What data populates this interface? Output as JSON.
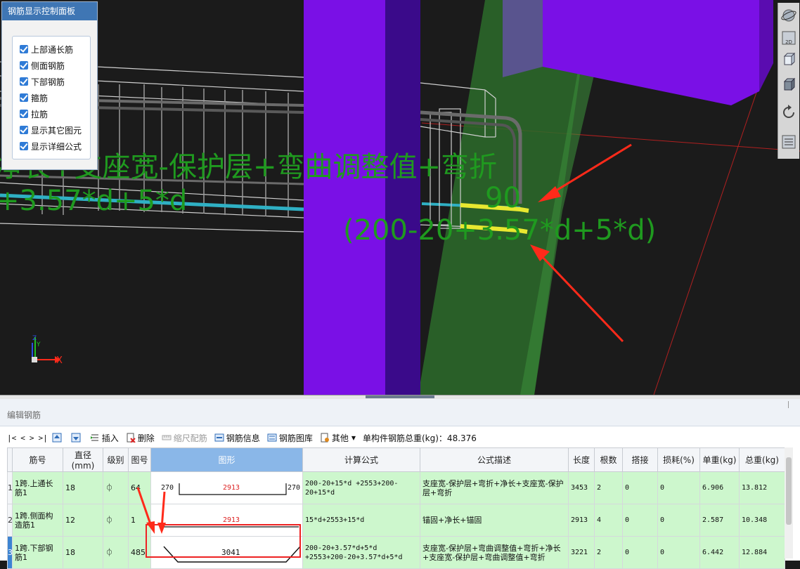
{
  "overlay": {
    "formula_line1": "净长+支座宽-保护层+弯曲调整值+弯折",
    "formula_line2": "+3.57*d+5*d",
    "value_90": "90",
    "value_formula": "(200-20+3.57*d+5*d)"
  },
  "axes": {
    "x": "X",
    "y": "Y",
    "z": "Z"
  },
  "control_panel": {
    "title": "钢筋显示控制面板",
    "items": [
      {
        "label": "上部通长筋",
        "checked": true
      },
      {
        "label": "侧面钢筋",
        "checked": true
      },
      {
        "label": "下部钢筋",
        "checked": true
      },
      {
        "label": "箍筋",
        "checked": true
      },
      {
        "label": "拉筋",
        "checked": true
      },
      {
        "label": "显示其它图元",
        "checked": true
      },
      {
        "label": "显示详细公式",
        "checked": true
      }
    ]
  },
  "right_toolbar": {
    "items": [
      "orbit-icon",
      "2d-view-icon",
      "3d-box-icon",
      "solid-box-icon",
      "rotate-icon",
      "grid-view-icon"
    ],
    "view_label": "2D"
  },
  "editor": {
    "title": "编辑钢筋",
    "toolbar": {
      "nav": [
        "|<",
        "<",
        ">",
        ">|"
      ],
      "insert": "插入",
      "delete": "删除",
      "scale": "缩尺配筋",
      "rebar_info": "钢筋信息",
      "rebar_library": "钢筋图库",
      "other": "其他",
      "total_label": "单构件钢筋总重(kg)：48.376"
    },
    "columns": [
      "",
      "筋号",
      "直径(mm)",
      "级别",
      "图号",
      "图形",
      "计算公式",
      "公式描述",
      "长度",
      "根数",
      "搭接",
      "损耗(%)",
      "单重(kg)",
      "总重(kg)"
    ],
    "rows": [
      {
        "num": "1",
        "name": "1跨.上通长筋1",
        "diameter": "18",
        "grade": "⏀",
        "fig": "64",
        "shape_left": "270",
        "shape_mid": "2913",
        "shape_right": "270",
        "formula": "200-20+15*d +2553+200-20+15*d",
        "desc": "支座宽-保护层+弯折+净长+支座宽-保护层+弯折",
        "length": "3453",
        "count": "2",
        "lap": "0",
        "loss": "0",
        "unit_wt": "6.906",
        "total_wt": "13.812"
      },
      {
        "num": "2",
        "name": "1跨.侧面构造筋1",
        "diameter": "12",
        "grade": "⏀",
        "fig": "1",
        "shape_mid": "2913",
        "formula": "15*d+2553+15*d",
        "desc": "锚固+净长+锚固",
        "length": "2913",
        "count": "4",
        "lap": "0",
        "loss": "0",
        "unit_wt": "2.587",
        "total_wt": "10.348"
      },
      {
        "num": "3",
        "name": "1跨.下部钢筋1",
        "diameter": "18",
        "grade": "⏀",
        "fig": "485",
        "shape_mid": "3041",
        "formula": "200-20+3.57*d+5*d +2553+200-20+3.57*d+5*d",
        "desc": "支座宽-保护层+弯曲调整值+弯折+净长+支座宽-保护层+弯曲调整值+弯折",
        "length": "3221",
        "count": "2",
        "lap": "0",
        "loss": "0",
        "unit_wt": "6.442",
        "total_wt": "12.884"
      }
    ]
  },
  "colors": {
    "beam_purple": "#7a10e6",
    "column_green": "#2c6b2a",
    "overlay_green": "#1f9a1f",
    "row_green": "#cdf7cd",
    "accent_blue": "#3f76b4",
    "arrow_red": "#ff2a1a"
  }
}
